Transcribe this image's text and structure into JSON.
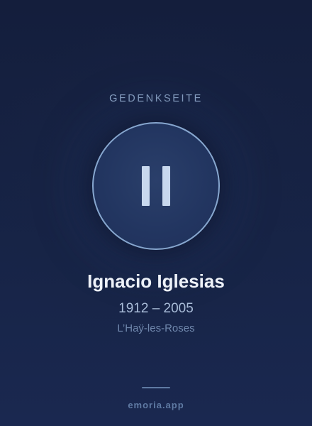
{
  "memorial": {
    "eyebrow": "GEDENKSEITE",
    "name": "Ignacio Iglesias",
    "years": "1912 – 2005",
    "place": "L’Haÿ-les-Roses"
  },
  "player": {
    "state_icon": "pause-icon"
  },
  "footer": {
    "brand": "emoria.app"
  },
  "colors": {
    "background": "#172447",
    "accent_ring": "#87a7cf",
    "text_primary": "#eef2f9",
    "text_secondary": "#a9bcd8",
    "text_muted": "#5f7aa3"
  }
}
